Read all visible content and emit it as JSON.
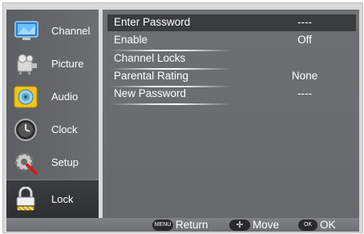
{
  "sidebar": {
    "items": [
      {
        "label": "Channel",
        "icon": "channel-monitor-icon"
      },
      {
        "label": "Picture",
        "icon": "picture-projector-icon"
      },
      {
        "label": "Audio",
        "icon": "audio-speaker-icon"
      },
      {
        "label": "Clock",
        "icon": "clock-icon"
      },
      {
        "label": "Setup",
        "icon": "setup-gear-icon"
      },
      {
        "label": "Lock",
        "icon": "lock-icon"
      }
    ],
    "selected": "Lock"
  },
  "main": {
    "rows": [
      {
        "label": "Enter Password",
        "value": "----",
        "highlighted": true
      },
      {
        "label": "Enable",
        "value": "Off"
      },
      {
        "label": "Channel Locks",
        "value": ""
      },
      {
        "label": "Parental Rating",
        "value": "None"
      },
      {
        "label": "New Password",
        "value": "----"
      }
    ]
  },
  "footer": {
    "return_btn": "MENU",
    "return_label": "Return",
    "move_btn": "✛",
    "move_label": "Move",
    "ok_btn": "OK",
    "ok_label": "OK"
  },
  "colors": {
    "panel": "#6c6e71",
    "highlight_row": "#3b3c3e",
    "text": "#ffffff"
  }
}
